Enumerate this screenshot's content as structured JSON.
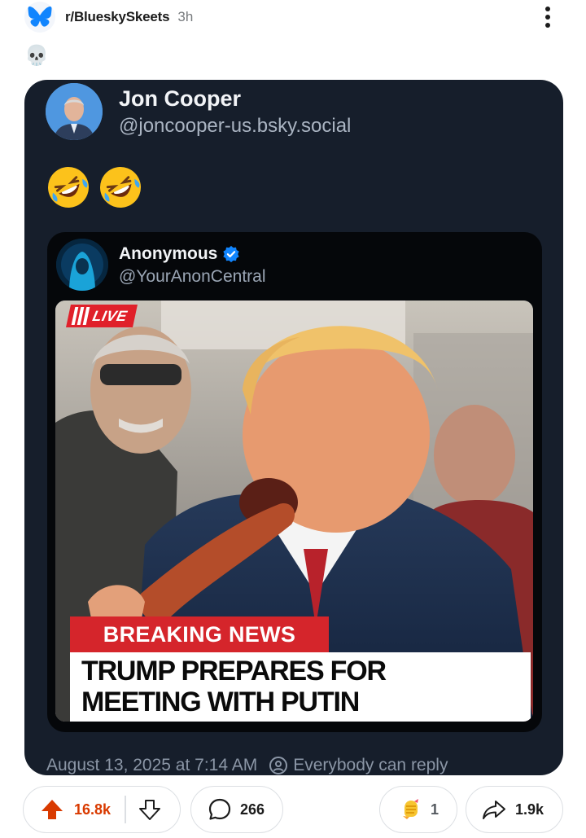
{
  "post": {
    "subreddit": "r/BlueskySkeets",
    "age": "3h",
    "title": "💀"
  },
  "skeet": {
    "author_name": "Jon Cooper",
    "author_handle": "@joncooper-us.bsky.social",
    "text": "🤣🤣",
    "date": "August 13, 2025 at 7:14 AM",
    "reply_setting": "Everybody can reply",
    "quote": {
      "author_name": "Anonymous",
      "author_handle": "@YourAnonCentral",
      "image": {
        "live_label": "LIVE",
        "banner": "BREAKING NEWS",
        "headline_line1": "TRUMP PREPARES FOR",
        "headline_line2": "MEETING WITH PUTIN"
      }
    }
  },
  "actions": {
    "upvotes": "16.8k",
    "comments": "266",
    "awards": "1",
    "shares": "1.9k"
  },
  "colors": {
    "card_bg": "#161e2b",
    "quote_bg": "#05070a",
    "upvote_accent": "#d93a00",
    "bluesky_blue": "#1185fe",
    "breaking_red": "#d5252b"
  },
  "icons": [
    "bluesky-butterfly-icon",
    "more-vertical-icon",
    "skull-emoji",
    "verified-badge-icon",
    "reply-settings-icon",
    "upvote-arrow-icon",
    "downvote-arrow-icon",
    "comment-bubble-icon",
    "award-icon",
    "share-arrow-icon"
  ]
}
